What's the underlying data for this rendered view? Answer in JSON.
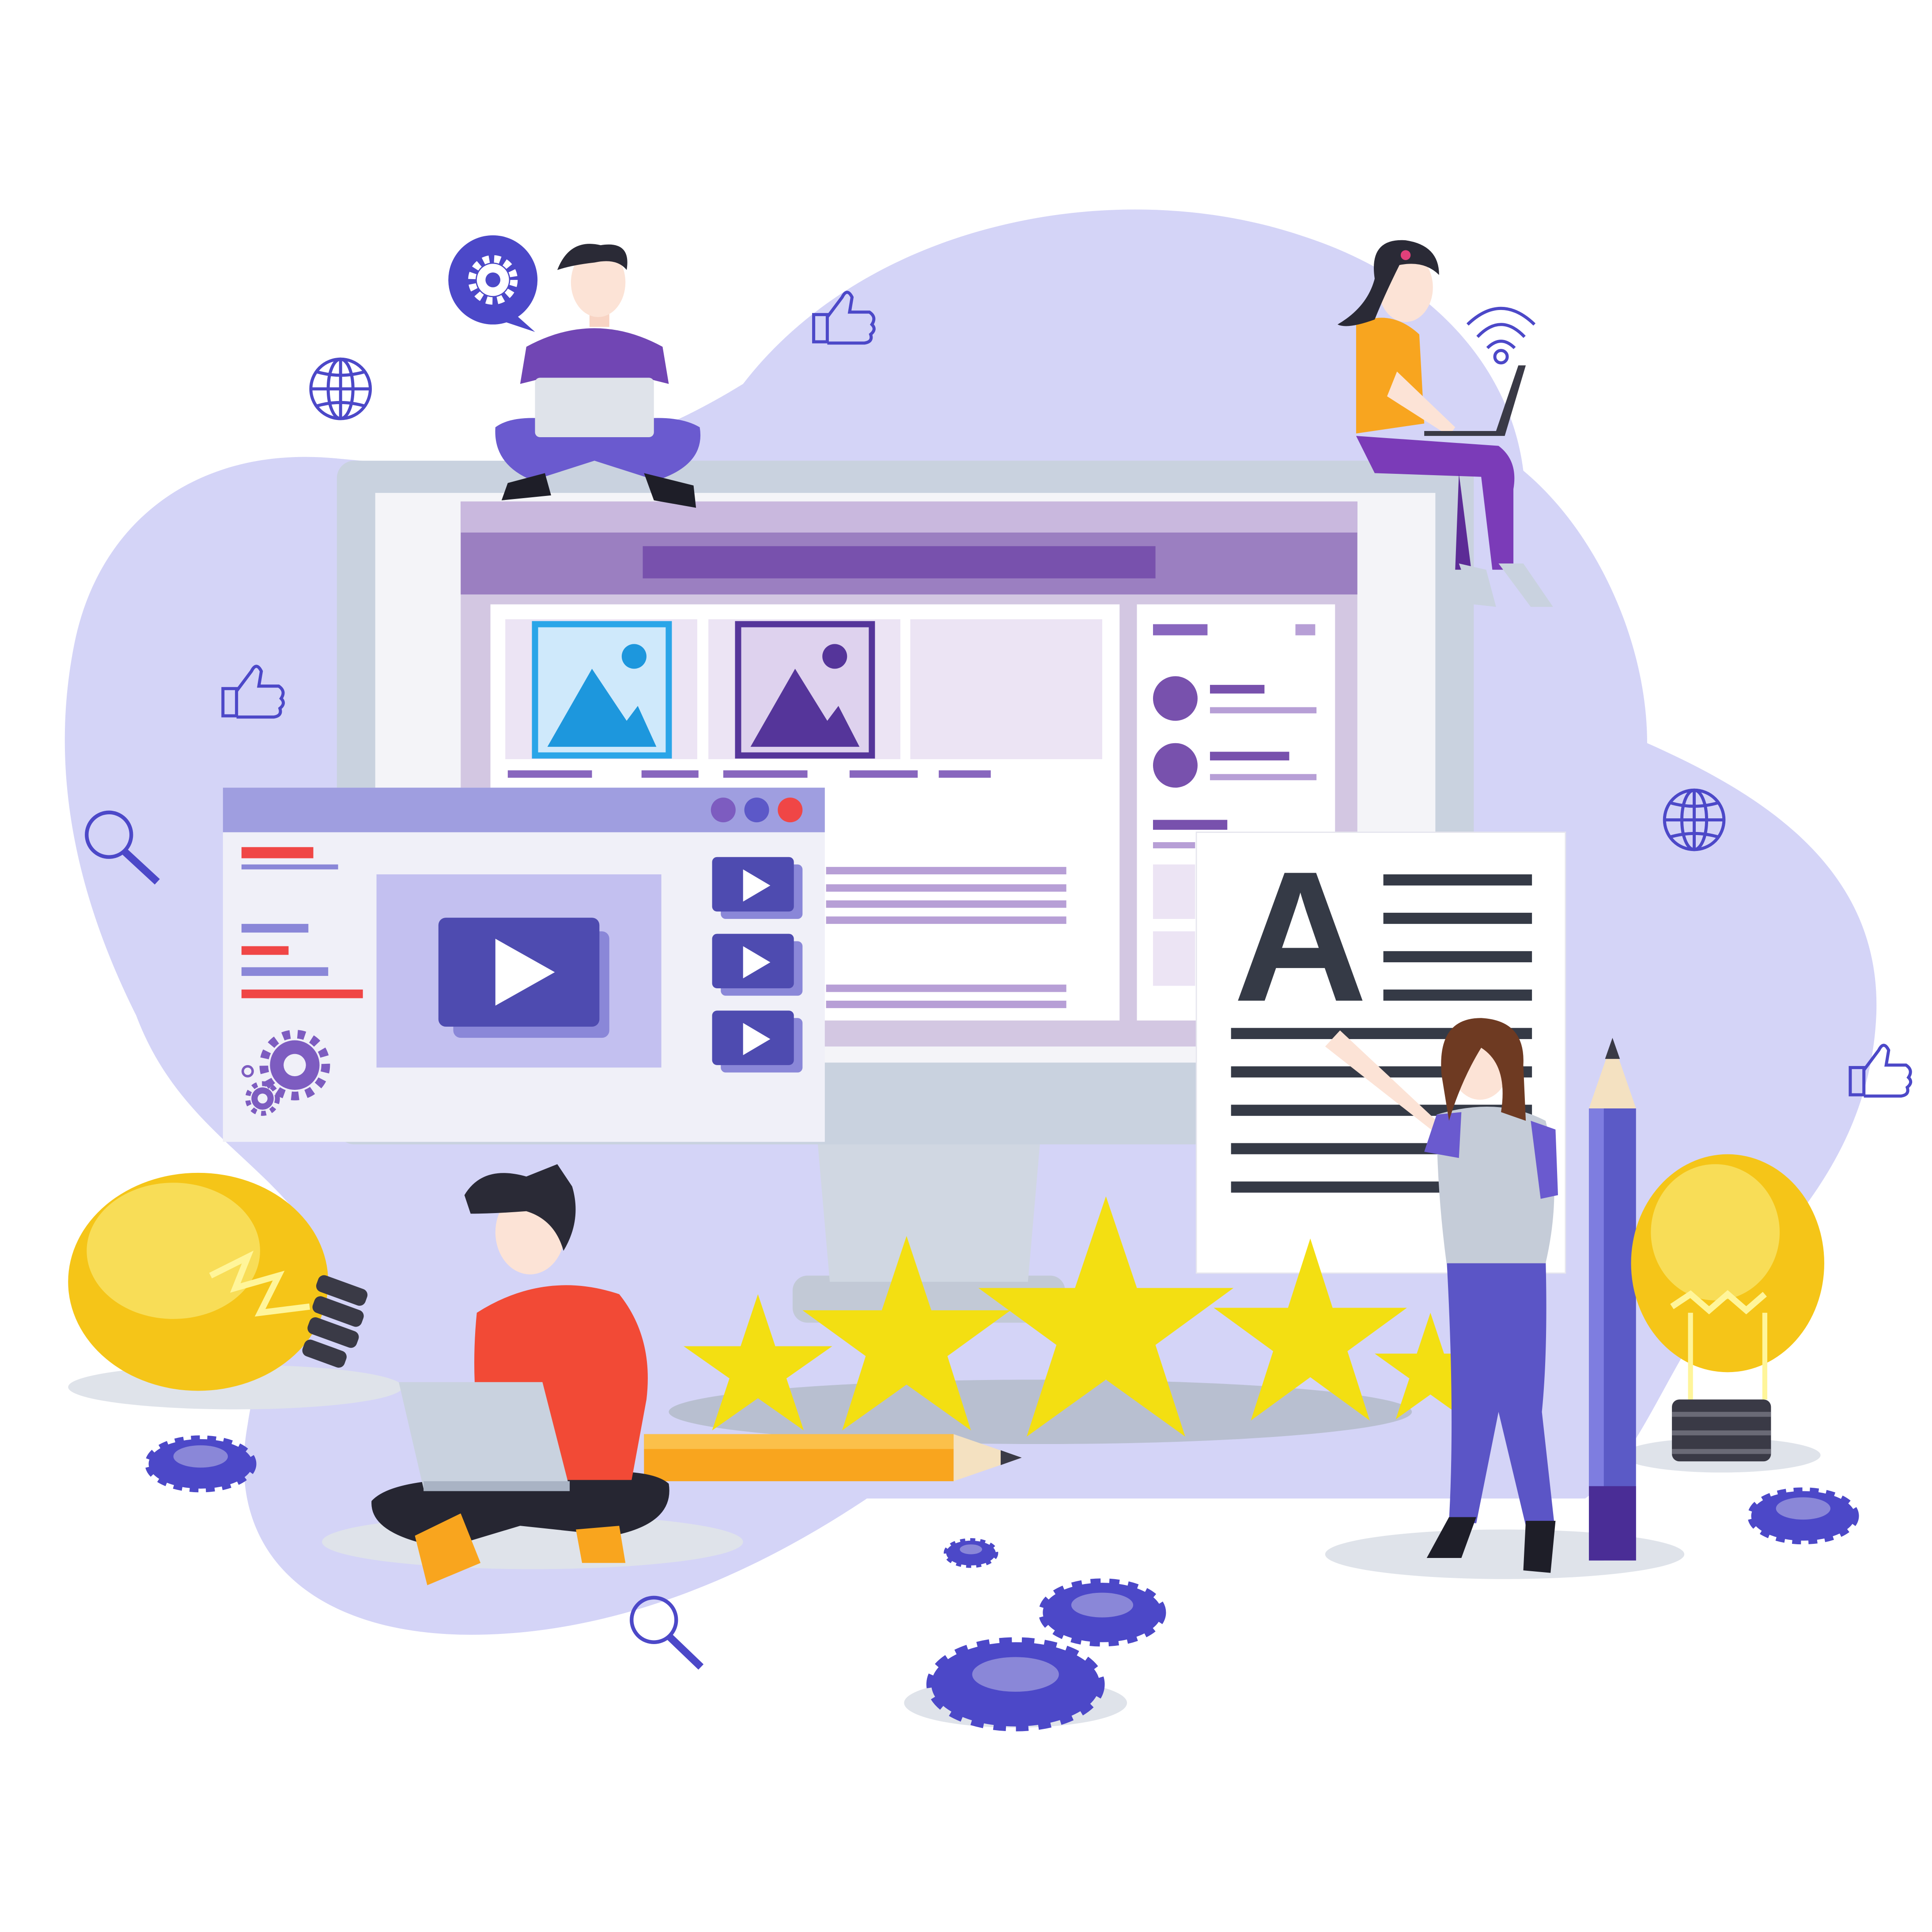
{
  "article_card": {
    "letter": "A"
  },
  "rating": {
    "stars_filled": 5,
    "stars_total": 5
  },
  "palette": {
    "blob": "#d4d4f7",
    "monitor_frame": "#c9d2df",
    "monitor_screen": "#f2f2f6",
    "browser_header": "#9b7fc1",
    "browser_bar": "#7851ad",
    "accent_purple": "#5b3fa3",
    "video_purple": "#4e4bb0",
    "star_yellow": "#f3df12",
    "bulb_yellow": "#f5c518",
    "gear_blue": "#4c48c8",
    "red_accent": "#f04646",
    "orange_shirt": "#f8a51f",
    "red_shirt": "#f24a36"
  },
  "icons": [
    "globe-icon",
    "thumbs-up-icon",
    "magnifier-icon",
    "wifi-icon",
    "gear-icon",
    "play-icon",
    "image-icon",
    "lightbulb-icon",
    "star-icon",
    "pencil-icon"
  ]
}
